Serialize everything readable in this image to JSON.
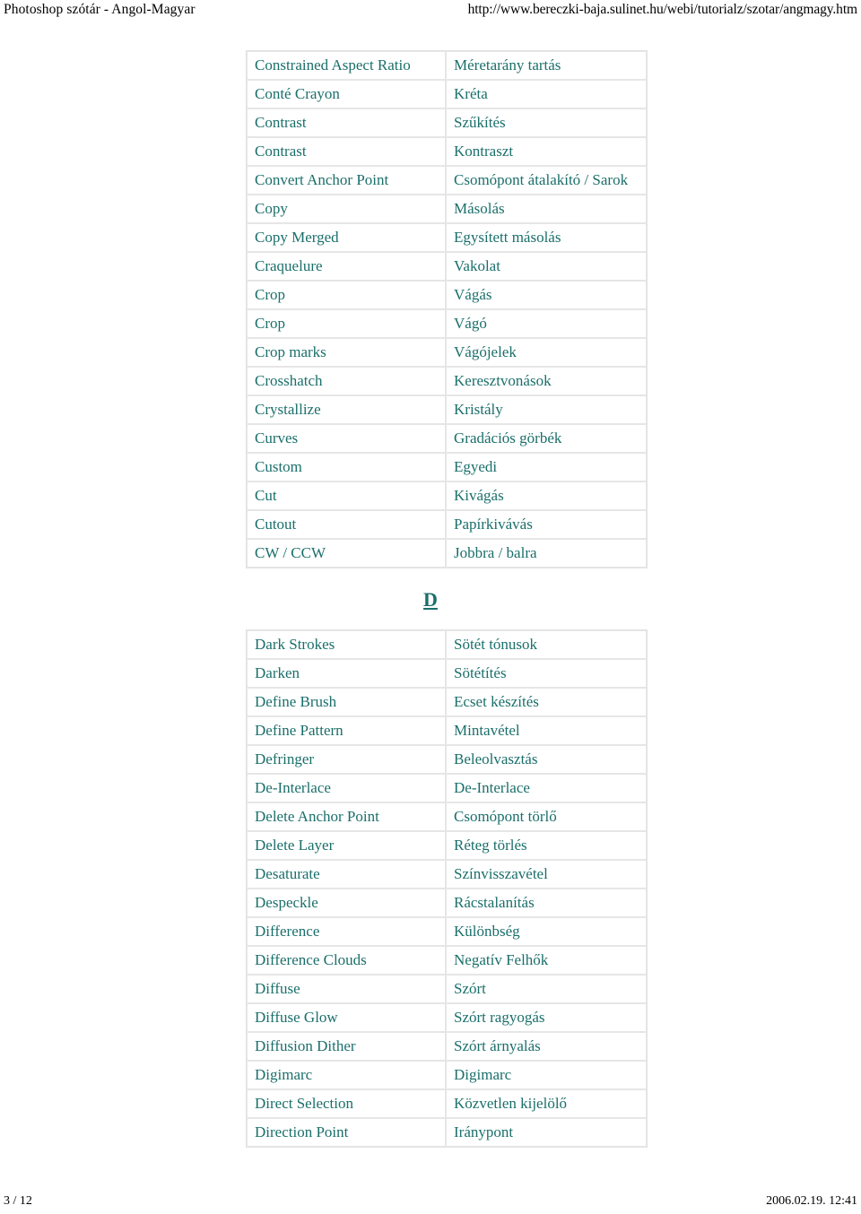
{
  "page_header": {
    "title": "Photoshop szótár - Angol-Magyar",
    "url": "http://www.bereczki-baja.sulinet.hu/webi/tutorialz/szotar/angmagy.htm"
  },
  "page_footer": {
    "page_number": "3 / 12",
    "timestamp": "2006.02.19. 12:41"
  },
  "theme": {
    "text_color": "#1a6f6b",
    "border_color": "#e6e6e6",
    "background": "#ffffff",
    "header_text_color": "#000000"
  },
  "sections": [
    {
      "id": "section-c",
      "letter": null,
      "rows": [
        {
          "en": "Constrained Aspect Ratio",
          "hu": "Méretarány tartás"
        },
        {
          "en": "Conté Crayon",
          "hu": "Kréta"
        },
        {
          "en": "Contrast",
          "hu": "Szűkítés"
        },
        {
          "en": "Contrast",
          "hu": "Kontraszt"
        },
        {
          "en": "Convert Anchor Point",
          "hu": "Csomópont átalakító / Sarok"
        },
        {
          "en": "Copy",
          "hu": "Másolás"
        },
        {
          "en": "Copy Merged",
          "hu": "Egysített másolás"
        },
        {
          "en": "Craquelure",
          "hu": "Vakolat"
        },
        {
          "en": "Crop",
          "hu": "Vágás"
        },
        {
          "en": "Crop",
          "hu": "Vágó"
        },
        {
          "en": "Crop marks",
          "hu": "Vágójelek"
        },
        {
          "en": "Crosshatch",
          "hu": "Keresztvonások"
        },
        {
          "en": "Crystallize",
          "hu": "Kristály"
        },
        {
          "en": "Curves",
          "hu": "Gradációs görbék"
        },
        {
          "en": "Custom",
          "hu": "Egyedi"
        },
        {
          "en": "Cut",
          "hu": "Kivágás"
        },
        {
          "en": "Cutout",
          "hu": "Papírkivávás"
        },
        {
          "en": "CW / CCW",
          "hu": "Jobbra / balra"
        }
      ]
    },
    {
      "id": "section-d",
      "letter": "D",
      "rows": [
        {
          "en": "Dark Strokes",
          "hu": "Sötét tónusok"
        },
        {
          "en": "Darken",
          "hu": "Sötétítés"
        },
        {
          "en": "Define Brush",
          "hu": "Ecset készítés"
        },
        {
          "en": "Define Pattern",
          "hu": "Mintavétel"
        },
        {
          "en": "Defringer",
          "hu": "Beleolvasztás"
        },
        {
          "en": "De-Interlace",
          "hu": "De-Interlace"
        },
        {
          "en": "Delete Anchor Point",
          "hu": "Csomópont törlő"
        },
        {
          "en": "Delete Layer",
          "hu": "Réteg törlés"
        },
        {
          "en": "Desaturate",
          "hu": "Színvisszavétel"
        },
        {
          "en": "Despeckle",
          "hu": "Rácstalanítás"
        },
        {
          "en": "Difference",
          "hu": "Különbség"
        },
        {
          "en": "Difference Clouds",
          "hu": "Negatív Felhők"
        },
        {
          "en": "Diffuse",
          "hu": "Szórt"
        },
        {
          "en": "Diffuse Glow",
          "hu": "Szórt ragyogás"
        },
        {
          "en": "Diffusion Dither",
          "hu": "Szórt árnyalás"
        },
        {
          "en": "Digimarc",
          "hu": "Digimarc"
        },
        {
          "en": "Direct Selection",
          "hu": "Közvetlen kijelölő"
        },
        {
          "en": "Direction Point",
          "hu": "Iránypont"
        }
      ]
    }
  ]
}
